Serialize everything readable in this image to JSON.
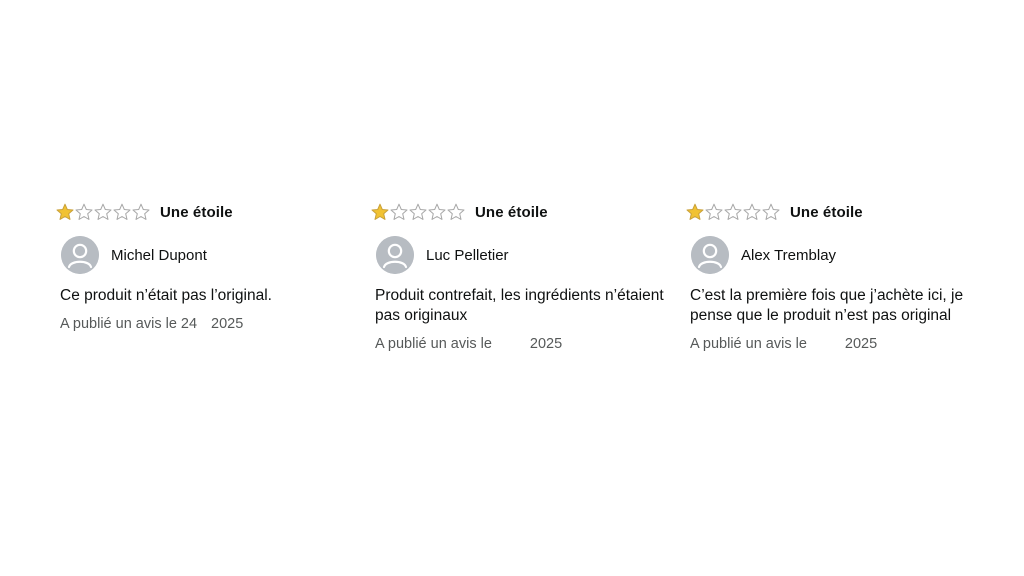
{
  "reviews": [
    {
      "rating": 1,
      "rating_max": 5,
      "rating_title": "Une étoile",
      "profile_name": "Michel Dupont",
      "text": "Ce produit n’était pas l’original.",
      "date_prefix": "A publié un avis le 24",
      "date_year": "2025"
    },
    {
      "rating": 1,
      "rating_max": 5,
      "rating_title": "Une étoile",
      "profile_name": "Luc Pelletier",
      "text": "Produit contrefait, les ingrédients n’étaient pas originaux",
      "date_prefix": "A publié un avis le",
      "date_year": "2025"
    },
    {
      "rating": 1,
      "rating_max": 5,
      "rating_title": "Une étoile",
      "profile_name": "Alex Tremblay",
      "text": "C’est la première fois que j’achète ici, je pense que le produit n’est pas original",
      "date_prefix": "A publié un avis le",
      "date_year": "2025"
    }
  ],
  "icons": {
    "star_filled": "star-filled-icon",
    "star_empty": "star-empty-icon",
    "avatar": "user-avatar-icon"
  },
  "colors": {
    "star_fill": "#f1c232",
    "star_stroke": "#c9a13a",
    "star_empty_stroke": "#a7a7a7",
    "avatar_bg": "#b7bcc2",
    "text": "#0f1111",
    "muted": "#565959"
  }
}
